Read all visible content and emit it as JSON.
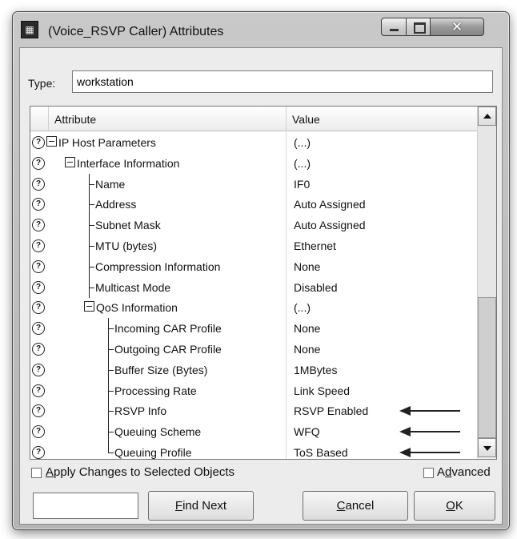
{
  "window": {
    "title": "(Voice_RSVP Caller) Attributes",
    "icon": "app-window-icon",
    "controls": [
      "minimize-icon",
      "maximize-icon",
      "close-icon"
    ]
  },
  "type_field": {
    "label": "Type:",
    "value": "workstation"
  },
  "table": {
    "headers": {
      "attribute": "Attribute",
      "value": "Value"
    },
    "rows": [
      {
        "attr": "IP Host Parameters",
        "value": "(...)",
        "level": 0,
        "kind": "group"
      },
      {
        "attr": "Interface Information",
        "value": "(...)",
        "level": 1,
        "kind": "group"
      },
      {
        "attr": "Name",
        "value": "IF0",
        "level": 2,
        "kind": "tee"
      },
      {
        "attr": "Address",
        "value": "Auto Assigned",
        "level": 2,
        "kind": "tee"
      },
      {
        "attr": "Subnet Mask",
        "value": "Auto Assigned",
        "level": 2,
        "kind": "tee"
      },
      {
        "attr": "MTU (bytes)",
        "value": "Ethernet",
        "level": 2,
        "kind": "tee"
      },
      {
        "attr": "Compression Information",
        "value": "None",
        "level": 2,
        "kind": "tee"
      },
      {
        "attr": "Multicast Mode",
        "value": "Disabled",
        "level": 2,
        "kind": "tee"
      },
      {
        "attr": "QoS Information",
        "value": "(...)",
        "level": 2,
        "kind": "group"
      },
      {
        "attr": "Incoming CAR Profile",
        "value": "None",
        "level": 3,
        "kind": "tee"
      },
      {
        "attr": "Outgoing CAR Profile",
        "value": "None",
        "level": 3,
        "kind": "tee"
      },
      {
        "attr": "Buffer Size (Bytes)",
        "value": "1MBytes",
        "level": 3,
        "kind": "tee"
      },
      {
        "attr": "Processing Rate",
        "value": "Link Speed",
        "level": 3,
        "kind": "tee"
      },
      {
        "attr": "RSVP Info",
        "value": "RSVP Enabled",
        "level": 3,
        "kind": "tee",
        "arrow": true
      },
      {
        "attr": "Queuing Scheme",
        "value": "WFQ",
        "level": 3,
        "kind": "tee",
        "arrow": true
      },
      {
        "attr": "Queuing Profile",
        "value": "ToS Based",
        "level": 3,
        "kind": "last",
        "arrow": true
      }
    ]
  },
  "options": {
    "apply_changes": {
      "prefix": "A",
      "rest": "pply Changes to Selected Objects",
      "checked": false
    },
    "advanced": {
      "prefix": "A",
      "mnemonic": "d",
      "rest": "vanced",
      "checked": false
    }
  },
  "buttons": {
    "find_next": {
      "mnemonic": "F",
      "rest": "ind Next"
    },
    "cancel": {
      "mnemonic": "C",
      "rest": "ancel"
    },
    "ok": {
      "mnemonic": "O",
      "rest": "K"
    }
  },
  "find_field": {
    "value": ""
  }
}
